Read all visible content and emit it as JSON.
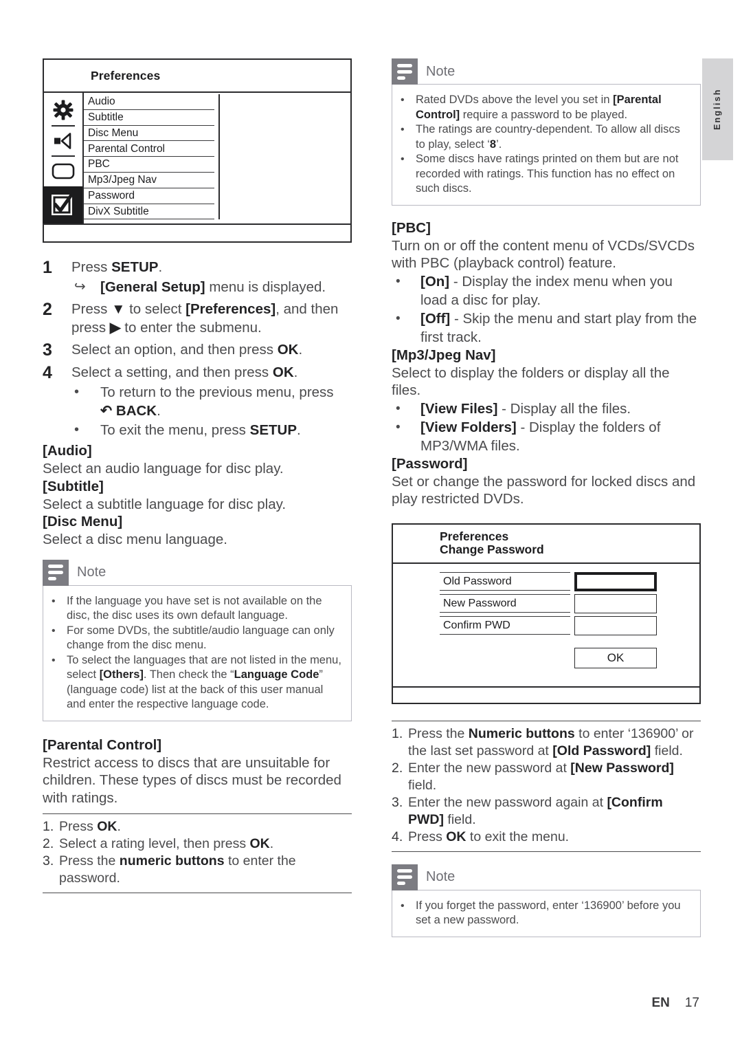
{
  "language_tab": "English",
  "footer": {
    "locale": "EN",
    "page": "17"
  },
  "preferences_screen": {
    "title": "Preferences",
    "icons": [
      "gear-icon",
      "speaker-icon",
      "video-screen-icon",
      "preferences-check-icon"
    ],
    "items": [
      "Audio",
      "Subtitle",
      "Disc Menu",
      "Parental Control",
      "PBC",
      "Mp3/Jpeg Nav",
      "Password",
      "DivX Subtitle"
    ]
  },
  "steps": [
    {
      "num": "1",
      "text": "Press SETUP.",
      "text_pre": "Press ",
      "bold": "SETUP",
      "text_post": "."
    },
    {
      "num": "2",
      "text": "Press ▼ to select [Preferences], and then press ▶ to enter the submenu."
    },
    {
      "num": "3",
      "text": "Select an option, and then press OK."
    },
    {
      "num": "4",
      "text": "Select a setting, and then press OK."
    }
  ],
  "step1_result": "[General Setup] menu is displayed.",
  "step1_result_bold": "[General Setup]",
  "step1_result_rest": " menu is displayed.",
  "step2_pre": "Press ",
  "step2_arrow_down": "▼",
  "step2_mid": " to select ",
  "step2_bold": "[Preferences]",
  "step2_after": ", and then press ",
  "step2_arrow_right": "▶",
  "step2_end": " to enter the submenu.",
  "step3_pre": "Select an option, and then press ",
  "step3_bold": "OK",
  "step3_end": ".",
  "step4_pre": "Select a setting, and then press ",
  "step4_bold": "OK",
  "step4_end": ".",
  "step4_sub1_pre": "To return to the previous menu, press ",
  "step4_sub1_icon": "↶",
  "step4_sub1_bold": "BACK",
  "step4_sub1_end": ".",
  "step4_sub2_pre": "To exit the menu, press ",
  "step4_sub2_bold": "SETUP",
  "step4_sub2_end": ".",
  "sections": {
    "audio": {
      "heading": "[Audio]",
      "body": "Select an audio language for disc play."
    },
    "subtitle": {
      "heading": "[Subtitle]",
      "body": "Select a subtitle language for disc play."
    },
    "disc_menu": {
      "heading": "[Disc Menu]",
      "body": "Select a disc menu language."
    },
    "parental_control": {
      "heading": "[Parental Control]",
      "body": "Restrict access to discs that are unsuitable for children. These types of discs must be recorded with ratings."
    },
    "pbc": {
      "heading": "[PBC]",
      "body": "Turn on or off the content menu of VCDs/SVCDs with PBC (playback control) feature.",
      "option_on_bold": "[On]",
      "option_on_rest": " - Display the index menu when you load a disc for play.",
      "option_off_bold": "[Off]",
      "option_off_rest": " - Skip the menu and start play from the first track."
    },
    "mp3_jpeg_nav": {
      "heading": "[Mp3/Jpeg Nav]",
      "body": "Select to display the folders or display all the files.",
      "option_files_bold": "[View Files]",
      "option_files_rest": " - Display all the files.",
      "option_folders_bold": "[View Folders]",
      "option_folders_rest": " - Display the folders of MP3/WMA files."
    },
    "password": {
      "heading": "[Password]",
      "body": "Set or change the password for locked discs and play restricted DVDs."
    }
  },
  "parental_steps": [
    {
      "n": "1.",
      "pre": "Press ",
      "bold": "OK",
      "post": "."
    },
    {
      "n": "2.",
      "pre": "Select a rating level, then press ",
      "bold": "OK",
      "post": "."
    },
    {
      "n": "3.",
      "pre": "Press the ",
      "bold": "numeric buttons",
      "post": " to enter the password."
    }
  ],
  "password_steps": [
    {
      "n": "1.",
      "pre": "Press the ",
      "bold": "Numeric buttons",
      "mid": " to enter ‘136900’ or the last set password at ",
      "bold2": "[Old Password]",
      "post": " field."
    },
    {
      "n": "2.",
      "pre": "Enter the new password at ",
      "bold": "[New Password]",
      "post": " field."
    },
    {
      "n": "3.",
      "pre": "Enter the new password again at ",
      "bold": "[Confirm PWD]",
      "post": " field."
    },
    {
      "n": "4.",
      "pre": "Press ",
      "bold": "OK",
      "post": " to exit the menu."
    }
  ],
  "change_password_screen": {
    "title_line1": "Preferences",
    "title_line2": "Change Password",
    "fields": [
      "Old Password",
      "New Password",
      "Confirm PWD"
    ],
    "ok_label": "OK"
  },
  "notes": {
    "note_label": "Note",
    "language_note": {
      "items": [
        {
          "text": "If the language you have set is not available on the disc, the disc uses its own default language."
        },
        {
          "text": "For some DVDs, the subtitle/audio language can only change from the disc menu."
        },
        {
          "pre": "To select the languages that are not listed in the menu, select ",
          "bold": "[Others]",
          "mid": ". Then check the “",
          "bold2": "Language Code",
          "post": "” (language code) list at the back of this user manual and enter the respective language code."
        }
      ]
    },
    "rating_note": {
      "items": [
        {
          "pre": "Rated DVDs above the level you set in ",
          "bold": "[Parental Control]",
          "post": " require a password to be played."
        },
        {
          "pre": "The ratings are country-dependent. To allow all discs to play, select ‘",
          "bold": "8",
          "post": "’."
        },
        {
          "text": "Some discs have ratings printed on them but are not recorded with ratings. This function has no effect on such discs."
        }
      ]
    },
    "forgot_note": {
      "items": [
        {
          "text": "If you forget the password, enter ‘136900’ before you set a new password."
        }
      ]
    }
  }
}
